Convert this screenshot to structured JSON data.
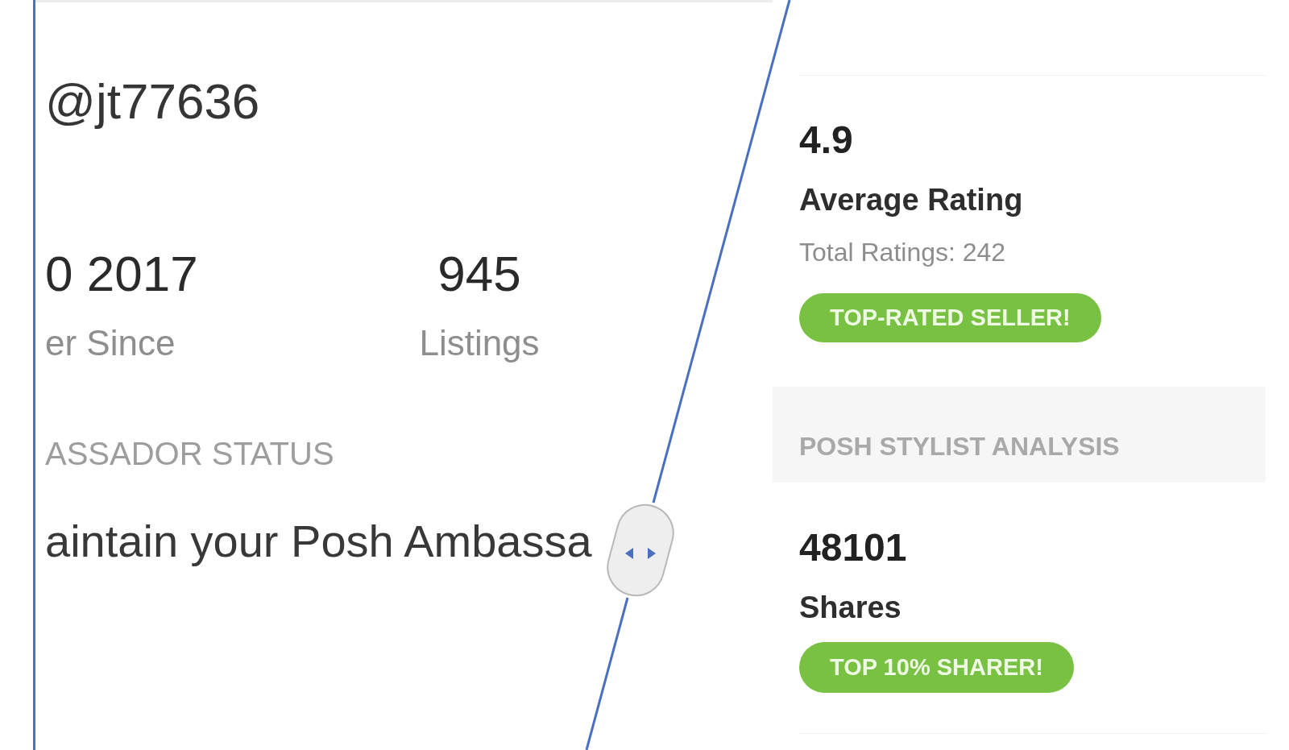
{
  "left_panel": {
    "username": "@jt77636",
    "stats": [
      {
        "value": "0 2017",
        "label": "er Since"
      },
      {
        "value": "945",
        "label": "Listings"
      }
    ],
    "section_heading": "ASSADOR STATUS",
    "status_text": "aintain your Posh Ambassa"
  },
  "right_panel": {
    "rating": {
      "value": "4.9",
      "label": "Average Rating",
      "detail": "Total Ratings: 242",
      "badge": "TOP-RATED SELLER!"
    },
    "section_heading": "POSH STYLIST ANALYSIS",
    "shares": {
      "value": "48101",
      "label": "Shares",
      "badge": "TOP 10% SHARER!"
    }
  }
}
